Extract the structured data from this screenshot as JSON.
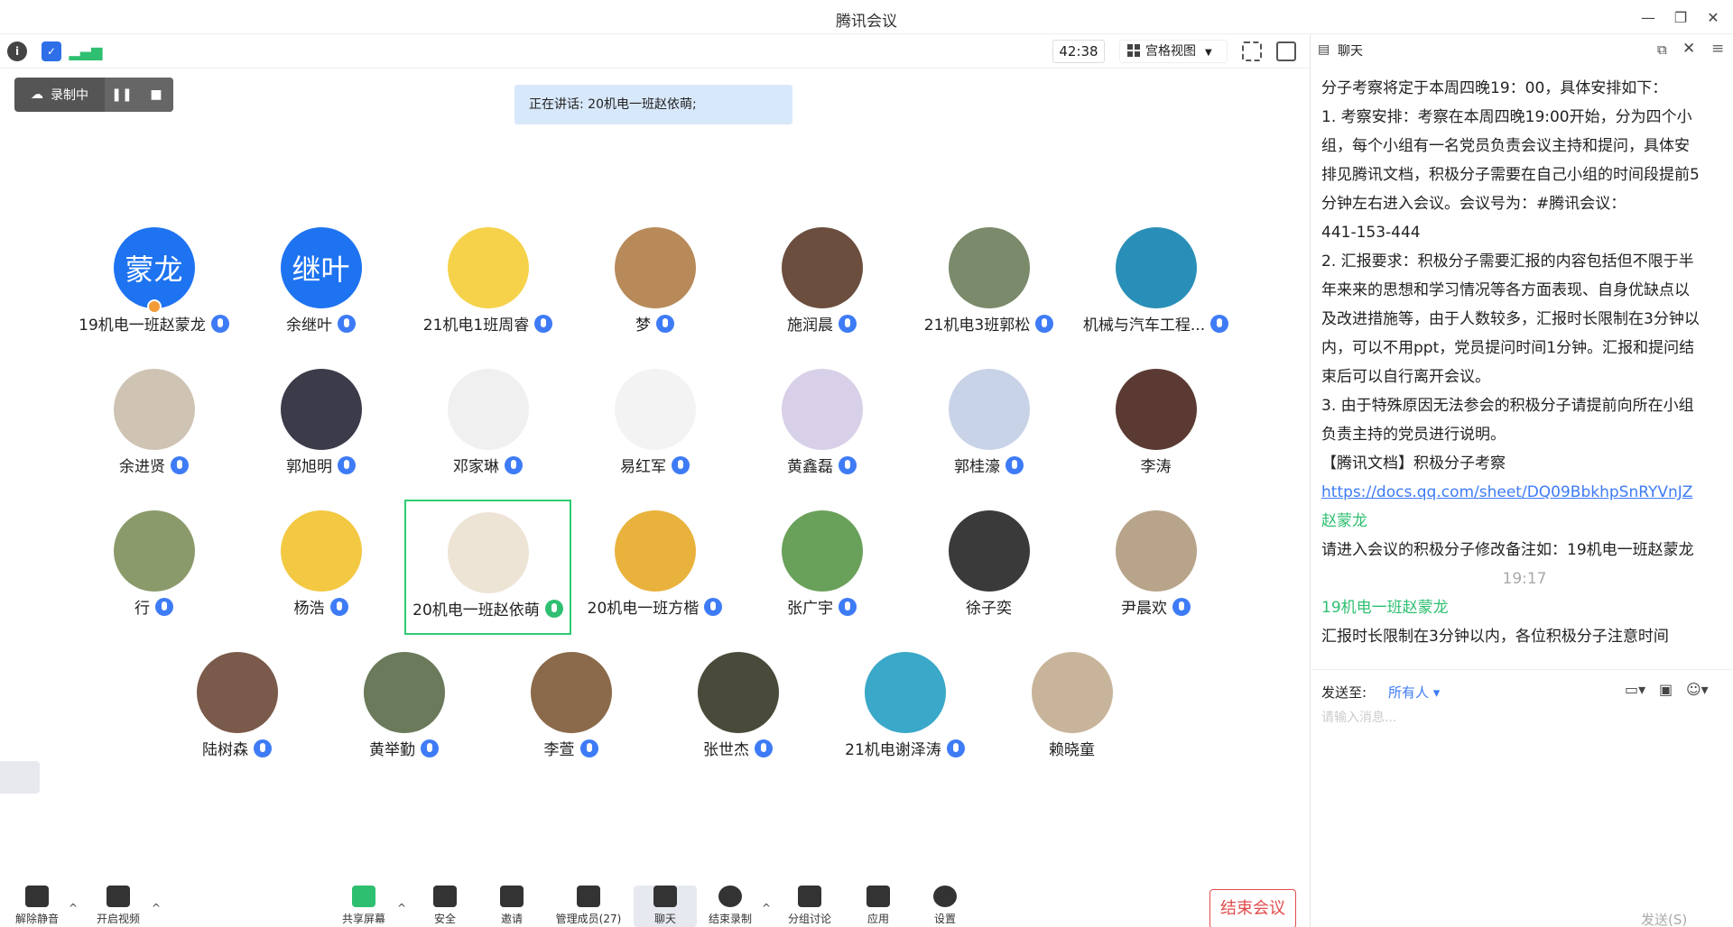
{
  "window": {
    "title": "腾讯会议"
  },
  "toolbar": {
    "timer": "42:38",
    "view_label": "宫格视图"
  },
  "recording": {
    "label": "录制中"
  },
  "speaking": {
    "text": "正在讲话: 20机电一班赵依萌;"
  },
  "participants": [
    {
      "name": "19机电一班赵蒙龙",
      "avatar_text": "蒙龙",
      "color": "#1e73f0"
    },
    {
      "name": "余继叶",
      "avatar_text": "继叶",
      "color": "#1e73f0"
    },
    {
      "name": "21机电1班周睿",
      "avatar_text": "",
      "color": "#f5d24a"
    },
    {
      "name": "梦",
      "avatar_text": "",
      "color": "#b88a5a"
    },
    {
      "name": "施润晨",
      "avatar_text": "",
      "color": "#6b4e3e"
    },
    {
      "name": "21机电3班郭松",
      "avatar_text": "",
      "color": "#7a8a6a"
    },
    {
      "name": "机械与汽车工程...",
      "avatar_text": "",
      "color": "#2a8fb8"
    },
    {
      "name": "余进贤",
      "avatar_text": "",
      "color": "#cfc3b3"
    },
    {
      "name": "郭旭明",
      "avatar_text": "",
      "color": "#3b3b4a"
    },
    {
      "name": "邓家琳",
      "avatar_text": "",
      "color": "#f0f0f0"
    },
    {
      "name": "易红军",
      "avatar_text": "",
      "color": "#f3f3f3"
    },
    {
      "name": "黄鑫磊",
      "avatar_text": "",
      "color": "#d8cfe8"
    },
    {
      "name": "郭桂濠",
      "avatar_text": "",
      "color": "#c9d3e8"
    },
    {
      "name": "李涛",
      "avatar_text": "",
      "color": "#5a3a32"
    },
    {
      "name": "行",
      "avatar_text": "",
      "color": "#8a9a6a"
    },
    {
      "name": "杨浩",
      "avatar_text": "",
      "color": "#f3c842"
    },
    {
      "name": "20机电一班赵依萌",
      "avatar_text": "",
      "color": "#ede4d6"
    },
    {
      "name": "20机电一班方楷",
      "avatar_text": "",
      "color": "#e9b23c"
    },
    {
      "name": "张广宇",
      "avatar_text": "",
      "color": "#6aa15a"
    },
    {
      "name": "徐子奕",
      "avatar_text": "",
      "color": "#3a3a3a"
    },
    {
      "name": "尹晨欢",
      "avatar_text": "",
      "color": "#b8a48a"
    },
    {
      "name": "陆树森",
      "avatar_text": "",
      "color": "#7a5a4a"
    },
    {
      "name": "黄举勤",
      "avatar_text": "",
      "color": "#6a7a5a"
    },
    {
      "name": "李萱",
      "avatar_text": "",
      "color": "#8a6a4a"
    },
    {
      "name": "张世杰",
      "avatar_text": "",
      "color": "#4a4a3a"
    },
    {
      "name": "21机电谢泽涛",
      "avatar_text": "",
      "color": "#3aa8c8"
    },
    {
      "name": "赖晓童",
      "avatar_text": "",
      "color": "#c8b49a"
    }
  ],
  "bottombar": {
    "unmute": "解除静音",
    "video": "开启视频",
    "share": "共享屏幕",
    "security": "安全",
    "invite": "邀请",
    "members": "管理成员(27)",
    "chat": "聊天",
    "end_record": "结束录制",
    "breakout": "分组讨论",
    "apps": "应用",
    "settings": "设置",
    "end_meeting": "结束会议"
  },
  "chat": {
    "title": "聊天",
    "lines": [
      "分子考察将定于本周四晚19：00，具体安排如下：",
      "1. 考察安排：考察在本周四晚19:00开始，分为四个小",
      "组，每个小组有一名党员负责会议主持和提问，具体安",
      "排见腾讯文档，积极分子需要在自己小组的时间段提前5",
      "分钟左右进入会议。会议号为：#腾讯会议：",
      "441-153-444",
      "2. 汇报要求：积极分子需要汇报的内容包括但不限于半",
      "年来来的思想和学习情况等各方面表现、自身优缺点以",
      "及改进措施等，由于人数较多，汇报时长限制在3分钟以",
      "内，可以不用ppt，党员提问时间1分钟。汇报和提问结",
      "束后可以自行离开会议。",
      "3. 由于特殊原因无法参会的积极分子请提前向所在小组",
      "负责主持的党员进行说明。",
      "【腾讯文档】积极分子考察"
    ],
    "link": "https://docs.qq.com/sheet/DQ09BbkhpSnRYVnJZ",
    "sender1": "赵蒙龙",
    "msg1": "请进入会议的积极分子修改备注如：19机电一班赵蒙龙",
    "time": "19:17",
    "sender2": "19机电一班赵蒙龙",
    "msg2": "汇报时长限制在3分钟以内，各位积极分子注意时间",
    "send_to_label": "发送至:",
    "send_to_value": "所有人",
    "input_placeholder": "请输入消息...",
    "send_label": "发送(S)"
  }
}
